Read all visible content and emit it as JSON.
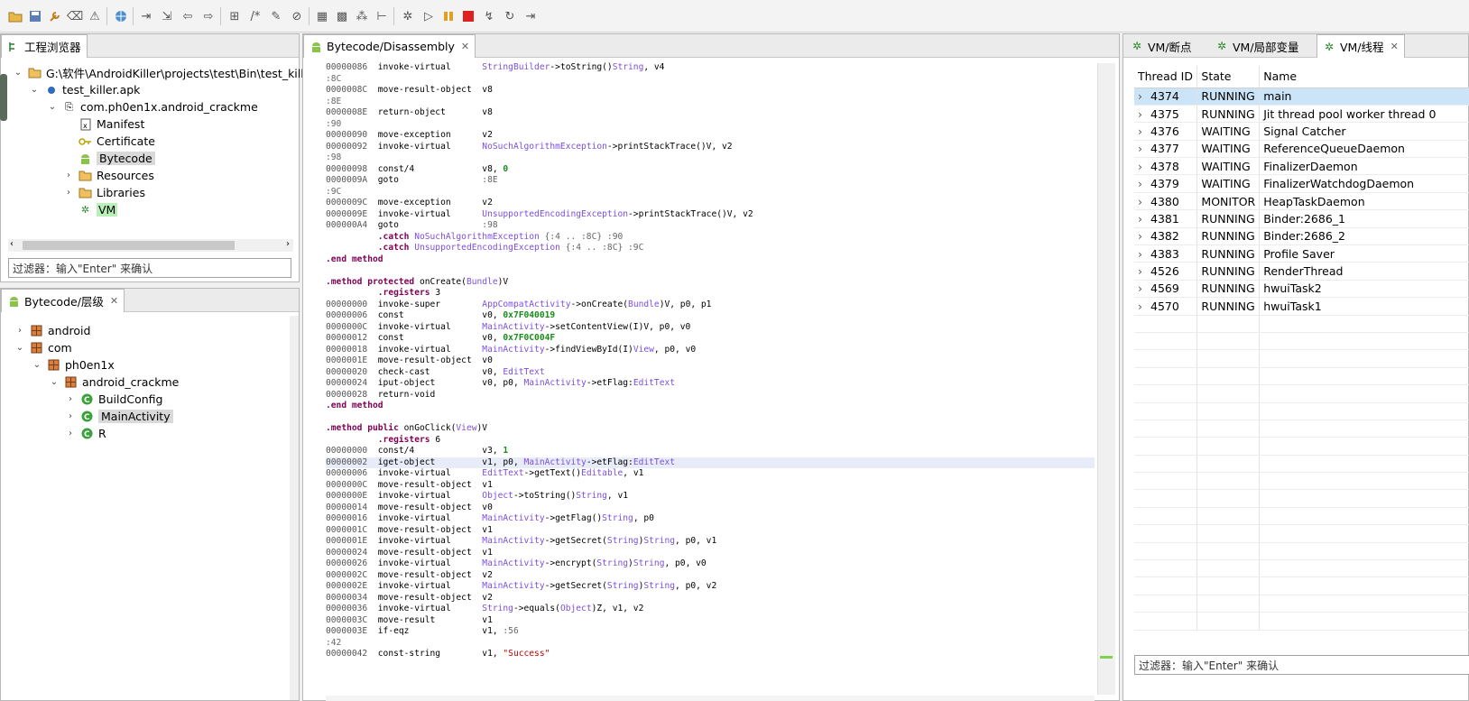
{
  "toolbar": {
    "icons": [
      "open-folder-icon",
      "save-icon",
      "wrench-icon",
      "erase-icon",
      "warning-icon",
      "globe-icon",
      "step-into-icon",
      "step-over-icon",
      "back-icon",
      "forward-icon",
      "attach-icon",
      "comment-icon",
      "edit-icon",
      "clear-icon",
      "grid-icon",
      "group-icon",
      "nodes-icon",
      "tree-icon",
      "bug-icon",
      "resume-icon",
      "pause-icon",
      "stop-icon",
      "step-return-icon",
      "cycle-icon",
      "export-icon"
    ]
  },
  "project_panel": {
    "tab_label": "工程浏览器",
    "tree": [
      {
        "label": "G:\\软件\\AndroidKiller\\projects\\test\\Bin\\test_killer"
      },
      {
        "label": "test_killer.apk"
      },
      {
        "label": "com.ph0en1x.android_crackme"
      },
      {
        "label": "Manifest"
      },
      {
        "label": "Certificate"
      },
      {
        "label": "Bytecode"
      },
      {
        "label": "Resources"
      },
      {
        "label": "Libraries"
      },
      {
        "label": "VM"
      }
    ],
    "filter_placeholder": "过滤器：输入\"Enter\" 来确认"
  },
  "hierarchy_panel": {
    "tab_label": "Bytecode/层级",
    "tree": [
      {
        "label": "android"
      },
      {
        "label": "com"
      },
      {
        "label": "ph0en1x"
      },
      {
        "label": "android_crackme"
      },
      {
        "label": "BuildConfig"
      },
      {
        "label": "MainActivity"
      },
      {
        "label": "R"
      }
    ]
  },
  "editor": {
    "tab_label": "Bytecode/Disassembly",
    "lines": [
      [
        [
          "00000086  ",
          "cd-addr"
        ],
        [
          "invoke-virtual      ",
          "cd-op"
        ],
        [
          "StringBuilder",
          "cd-cls"
        ],
        [
          "->toString()",
          "cd-op"
        ],
        [
          "String",
          "cd-cls"
        ],
        [
          ", v4",
          "cd-op"
        ]
      ],
      [
        [
          ":8C",
          "cd-lbl"
        ]
      ],
      [
        [
          "0000008C  ",
          "cd-addr"
        ],
        [
          "move-result-object  ",
          "cd-op"
        ],
        [
          "v8",
          "cd-op"
        ]
      ],
      [
        [
          ":8E",
          "cd-lbl"
        ]
      ],
      [
        [
          "0000008E  ",
          "cd-addr"
        ],
        [
          "return-object       ",
          "cd-op"
        ],
        [
          "v8",
          "cd-op"
        ]
      ],
      [
        [
          ":90",
          "cd-lbl"
        ]
      ],
      [
        [
          "00000090  ",
          "cd-addr"
        ],
        [
          "move-exception      ",
          "cd-op"
        ],
        [
          "v2",
          "cd-op"
        ]
      ],
      [
        [
          "00000092  ",
          "cd-addr"
        ],
        [
          "invoke-virtual      ",
          "cd-op"
        ],
        [
          "NoSuchAlgorithmException",
          "cd-cls"
        ],
        [
          "->printStackTrace()V, v2",
          "cd-op"
        ]
      ],
      [
        [
          ":98",
          "cd-lbl"
        ]
      ],
      [
        [
          "00000098  ",
          "cd-addr"
        ],
        [
          "const/4             ",
          "cd-op"
        ],
        [
          "v8, ",
          "cd-op"
        ],
        [
          "0",
          "cd-num"
        ]
      ],
      [
        [
          "0000009A  ",
          "cd-addr"
        ],
        [
          "goto                ",
          "cd-op"
        ],
        [
          ":8E",
          "cd-lbl"
        ]
      ],
      [
        [
          ":9C",
          "cd-lbl"
        ]
      ],
      [
        [
          "0000009C  ",
          "cd-addr"
        ],
        [
          "move-exception      ",
          "cd-op"
        ],
        [
          "v2",
          "cd-op"
        ]
      ],
      [
        [
          "0000009E  ",
          "cd-addr"
        ],
        [
          "invoke-virtual      ",
          "cd-op"
        ],
        [
          "UnsupportedEncodingException",
          "cd-cls"
        ],
        [
          "->printStackTrace()V, v2",
          "cd-op"
        ]
      ],
      [
        [
          "000000A4  ",
          "cd-addr"
        ],
        [
          "goto                ",
          "cd-op"
        ],
        [
          ":98",
          "cd-lbl"
        ]
      ],
      [
        [
          "          ",
          "cd-op"
        ],
        [
          ".catch ",
          "cd-kw"
        ],
        [
          "NoSuchAlgorithmException",
          "cd-cls"
        ],
        [
          " {:4 .. :8C} :90",
          "cd-lbl"
        ]
      ],
      [
        [
          "          ",
          "cd-op"
        ],
        [
          ".catch ",
          "cd-kw"
        ],
        [
          "UnsupportedEncodingException",
          "cd-cls"
        ],
        [
          " {:4 .. :8C} :9C",
          "cd-lbl"
        ]
      ],
      [
        [
          ".end method",
          "cd-kw"
        ]
      ],
      [],
      [
        [
          ".method protected ",
          "cd-kw"
        ],
        [
          "onCreate(",
          "cd-op"
        ],
        [
          "Bundle",
          "cd-cls"
        ],
        [
          ")V",
          "cd-op"
        ]
      ],
      [
        [
          "          ",
          "cd-op"
        ],
        [
          ".registers ",
          "cd-kw"
        ],
        [
          "3",
          "cd-op"
        ]
      ],
      [
        [
          "00000000  ",
          "cd-addr"
        ],
        [
          "invoke-super        ",
          "cd-op"
        ],
        [
          "AppCompatActivity",
          "cd-cls"
        ],
        [
          "->onCreate(",
          "cd-op"
        ],
        [
          "Bundle",
          "cd-cls"
        ],
        [
          ")V, p0, p1",
          "cd-op"
        ]
      ],
      [
        [
          "00000006  ",
          "cd-addr"
        ],
        [
          "const               ",
          "cd-op"
        ],
        [
          "v0, ",
          "cd-op"
        ],
        [
          "0x7F040019",
          "cd-num"
        ]
      ],
      [
        [
          "0000000C  ",
          "cd-addr"
        ],
        [
          "invoke-virtual      ",
          "cd-op"
        ],
        [
          "MainActivity",
          "cd-cls"
        ],
        [
          "->setContentView(I)V, p0, v0",
          "cd-op"
        ]
      ],
      [
        [
          "00000012  ",
          "cd-addr"
        ],
        [
          "const               ",
          "cd-op"
        ],
        [
          "v0, ",
          "cd-op"
        ],
        [
          "0x7F0C004F",
          "cd-num"
        ]
      ],
      [
        [
          "00000018  ",
          "cd-addr"
        ],
        [
          "invoke-virtual      ",
          "cd-op"
        ],
        [
          "MainActivity",
          "cd-cls"
        ],
        [
          "->findViewById(I)",
          "cd-op"
        ],
        [
          "View",
          "cd-cls"
        ],
        [
          ", p0, v0",
          "cd-op"
        ]
      ],
      [
        [
          "0000001E  ",
          "cd-addr"
        ],
        [
          "move-result-object  ",
          "cd-op"
        ],
        [
          "v0",
          "cd-op"
        ]
      ],
      [
        [
          "00000020  ",
          "cd-addr"
        ],
        [
          "check-cast          ",
          "cd-op"
        ],
        [
          "v0, ",
          "cd-op"
        ],
        [
          "EditText",
          "cd-cls"
        ]
      ],
      [
        [
          "00000024  ",
          "cd-addr"
        ],
        [
          "iput-object         ",
          "cd-op"
        ],
        [
          "v0, p0, ",
          "cd-op"
        ],
        [
          "MainActivity",
          "cd-cls"
        ],
        [
          "->etFlag:",
          "cd-op"
        ],
        [
          "EditText",
          "cd-cls"
        ]
      ],
      [
        [
          "00000028  ",
          "cd-addr"
        ],
        [
          "return-void",
          "cd-op"
        ]
      ],
      [
        [
          ".end method",
          "cd-kw"
        ]
      ],
      [],
      [
        [
          ".method public ",
          "cd-kw"
        ],
        [
          "onGoClick(",
          "cd-op"
        ],
        [
          "View",
          "cd-cls"
        ],
        [
          ")V",
          "cd-op"
        ]
      ],
      [
        [
          "          ",
          "cd-op"
        ],
        [
          ".registers ",
          "cd-kw"
        ],
        [
          "6",
          "cd-op"
        ]
      ],
      [
        [
          "00000000  ",
          "cd-addr"
        ],
        [
          "const/4             ",
          "cd-op"
        ],
        [
          "v3, ",
          "cd-op"
        ],
        [
          "1",
          "cd-num"
        ]
      ],
      [
        [
          "00000002  ",
          "cd-addr"
        ],
        [
          "iget-object         ",
          "cd-op"
        ],
        [
          "v1, p0, ",
          "cd-op"
        ],
        [
          "MainActivity",
          "cd-cls"
        ],
        [
          "->etFlag:",
          "cd-op"
        ],
        [
          "EditText",
          "cd-cls"
        ]
      ],
      [
        [
          "00000006  ",
          "cd-addr"
        ],
        [
          "invoke-virtual      ",
          "cd-op"
        ],
        [
          "EditText",
          "cd-cls"
        ],
        [
          "->getText()",
          "cd-op"
        ],
        [
          "Editable",
          "cd-cls"
        ],
        [
          ", v1",
          "cd-op"
        ]
      ],
      [
        [
          "0000000C  ",
          "cd-addr"
        ],
        [
          "move-result-object  ",
          "cd-op"
        ],
        [
          "v1",
          "cd-op"
        ]
      ],
      [
        [
          "0000000E  ",
          "cd-addr"
        ],
        [
          "invoke-virtual      ",
          "cd-op"
        ],
        [
          "Object",
          "cd-cls"
        ],
        [
          "->toString()",
          "cd-op"
        ],
        [
          "String",
          "cd-cls"
        ],
        [
          ", v1",
          "cd-op"
        ]
      ],
      [
        [
          "00000014  ",
          "cd-addr"
        ],
        [
          "move-result-object  ",
          "cd-op"
        ],
        [
          "v0",
          "cd-op"
        ]
      ],
      [
        [
          "00000016  ",
          "cd-addr"
        ],
        [
          "invoke-virtual      ",
          "cd-op"
        ],
        [
          "MainActivity",
          "cd-cls"
        ],
        [
          "->getFlag()",
          "cd-op"
        ],
        [
          "String",
          "cd-cls"
        ],
        [
          ", p0",
          "cd-op"
        ]
      ],
      [
        [
          "0000001C  ",
          "cd-addr"
        ],
        [
          "move-result-object  ",
          "cd-op"
        ],
        [
          "v1",
          "cd-op"
        ]
      ],
      [
        [
          "0000001E  ",
          "cd-addr"
        ],
        [
          "invoke-virtual      ",
          "cd-op"
        ],
        [
          "MainActivity",
          "cd-cls"
        ],
        [
          "->getSecret(",
          "cd-op"
        ],
        [
          "String",
          "cd-cls"
        ],
        [
          ")",
          "cd-op"
        ],
        [
          "String",
          "cd-cls"
        ],
        [
          ", p0, v1",
          "cd-op"
        ]
      ],
      [
        [
          "00000024  ",
          "cd-addr"
        ],
        [
          "move-result-object  ",
          "cd-op"
        ],
        [
          "v1",
          "cd-op"
        ]
      ],
      [
        [
          "00000026  ",
          "cd-addr"
        ],
        [
          "invoke-virtual      ",
          "cd-op"
        ],
        [
          "MainActivity",
          "cd-cls"
        ],
        [
          "->encrypt(",
          "cd-op"
        ],
        [
          "String",
          "cd-cls"
        ],
        [
          ")",
          "cd-op"
        ],
        [
          "String",
          "cd-cls"
        ],
        [
          ", p0, v0",
          "cd-op"
        ]
      ],
      [
        [
          "0000002C  ",
          "cd-addr"
        ],
        [
          "move-result-object  ",
          "cd-op"
        ],
        [
          "v2",
          "cd-op"
        ]
      ],
      [
        [
          "0000002E  ",
          "cd-addr"
        ],
        [
          "invoke-virtual      ",
          "cd-op"
        ],
        [
          "MainActivity",
          "cd-cls"
        ],
        [
          "->getSecret(",
          "cd-op"
        ],
        [
          "String",
          "cd-cls"
        ],
        [
          ")",
          "cd-op"
        ],
        [
          "String",
          "cd-cls"
        ],
        [
          ", p0, v2",
          "cd-op"
        ]
      ],
      [
        [
          "00000034  ",
          "cd-addr"
        ],
        [
          "move-result-object  ",
          "cd-op"
        ],
        [
          "v2",
          "cd-op"
        ]
      ],
      [
        [
          "00000036  ",
          "cd-addr"
        ],
        [
          "invoke-virtual      ",
          "cd-op"
        ],
        [
          "String",
          "cd-cls"
        ],
        [
          "->equals(",
          "cd-op"
        ],
        [
          "Object",
          "cd-cls"
        ],
        [
          ")Z, v1, v2",
          "cd-op"
        ]
      ],
      [
        [
          "0000003C  ",
          "cd-addr"
        ],
        [
          "move-result         ",
          "cd-op"
        ],
        [
          "v1",
          "cd-op"
        ]
      ],
      [
        [
          "0000003E  ",
          "cd-addr"
        ],
        [
          "if-eqz              ",
          "cd-op"
        ],
        [
          "v1, ",
          "cd-op"
        ],
        [
          ":56",
          "cd-lbl"
        ]
      ],
      [
        [
          ":42",
          "cd-lbl"
        ]
      ],
      [
        [
          "00000042  ",
          "cd-addr"
        ],
        [
          "const-string        ",
          "cd-op"
        ],
        [
          "v1, ",
          "cd-op"
        ],
        [
          "\"Success\"",
          "cd-str"
        ]
      ]
    ],
    "breakpoint_line": 35
  },
  "right_tabs": [
    {
      "label": "VM/断点"
    },
    {
      "label": "VM/局部变量"
    },
    {
      "label": "VM/线程"
    }
  ],
  "threads": {
    "columns": [
      "Thread ID",
      "State",
      "Name"
    ],
    "rows": [
      [
        "4374",
        "RUNNING",
        "main"
      ],
      [
        "4375",
        "RUNNING",
        "Jit thread pool worker thread 0"
      ],
      [
        "4376",
        "WAITING",
        "Signal Catcher"
      ],
      [
        "4377",
        "WAITING",
        "ReferenceQueueDaemon"
      ],
      [
        "4378",
        "WAITING",
        "FinalizerDaemon"
      ],
      [
        "4379",
        "WAITING",
        "FinalizerWatchdogDaemon"
      ],
      [
        "4380",
        "MONITOR",
        "HeapTaskDaemon"
      ],
      [
        "4381",
        "RUNNING",
        "Binder:2686_1"
      ],
      [
        "4382",
        "RUNNING",
        "Binder:2686_2"
      ],
      [
        "4383",
        "RUNNING",
        "Profile Saver"
      ],
      [
        "4526",
        "RUNNING",
        "RenderThread"
      ],
      [
        "4569",
        "RUNNING",
        "hwuiTask2"
      ],
      [
        "4570",
        "RUNNING",
        "hwuiTask1"
      ]
    ],
    "filter_placeholder": "过滤器：输入\"Enter\" 来确认"
  }
}
